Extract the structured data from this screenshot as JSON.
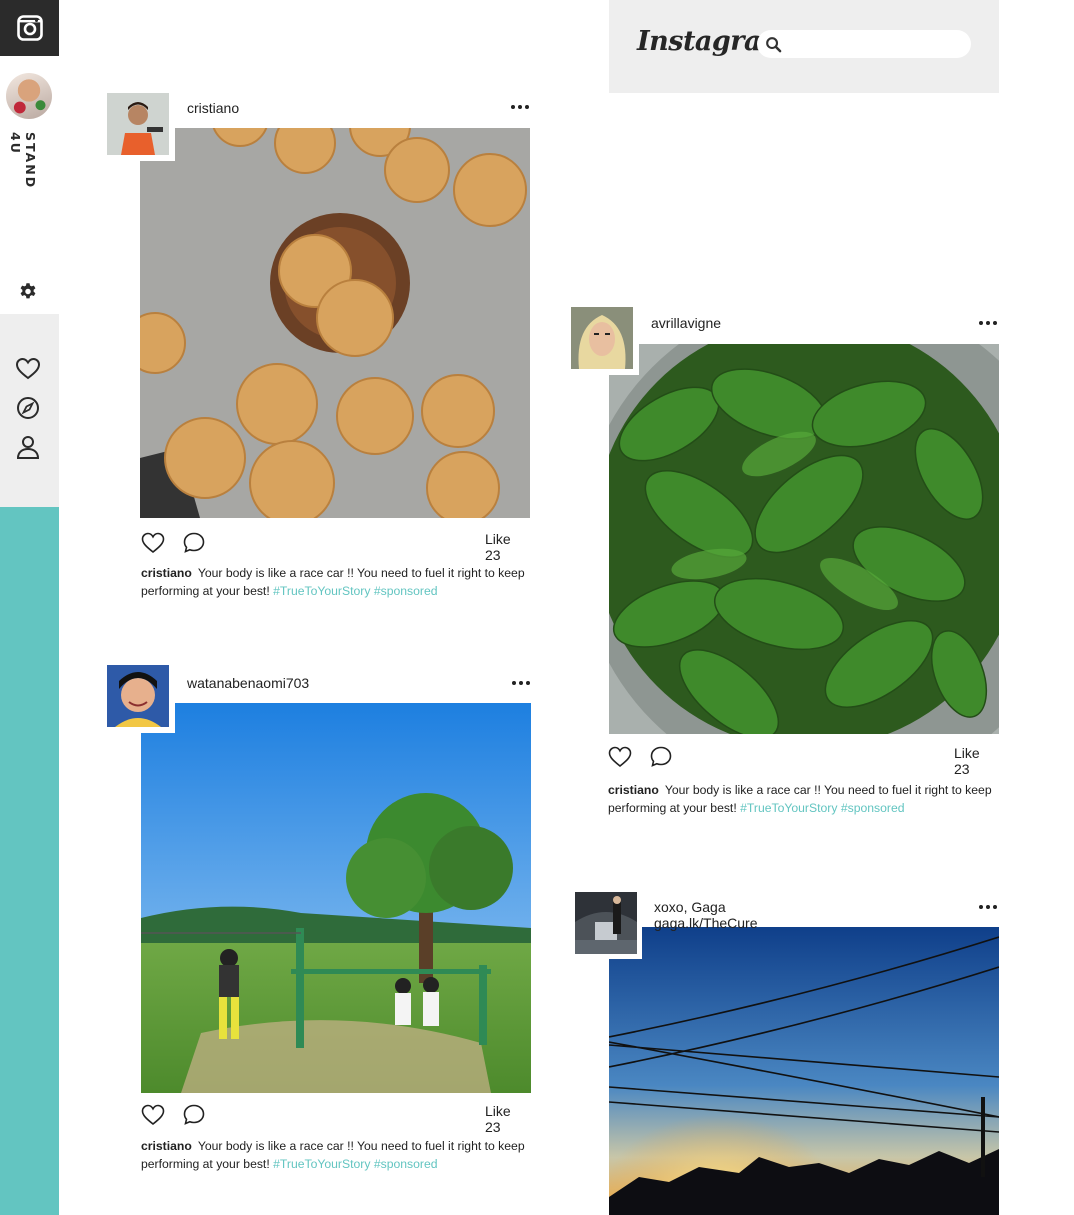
{
  "sidebar": {
    "brand": "STAND 4U",
    "icons": [
      "instagram-icon",
      "profile-avatar",
      "gear-icon",
      "heart-icon",
      "compass-icon",
      "user-icon"
    ]
  },
  "header": {
    "wordmark": "Instagram",
    "search_placeholder": ""
  },
  "posts": [
    {
      "username": "cristiano",
      "like_label": "Like 23",
      "caption_user": "cristiano",
      "caption_text": "Your body is like a race car  !! You need to fuel it right to keep performing at your best!",
      "hashtags": "#TrueToYourStory #sponsored"
    },
    {
      "username": "watanabenaomi703",
      "like_label": "Like 23",
      "caption_user": "cristiano",
      "caption_text": "Your body is like a race car  !! You need to fuel it right to keep performing at your best!",
      "hashtags": "#TrueToYourStory #sponsored"
    },
    {
      "username": "avrillavigne",
      "like_label": "Like 23",
      "caption_user": "cristiano",
      "caption_text": "Your body is like a race car  !! You need to fuel it right to keep performing at your best!",
      "hashtags": "#TrueToYourStory #sponsored"
    },
    {
      "username": "xoxo, Gaga gaga.lk/TheCure"
    }
  ],
  "colors": {
    "accent_teal": "#63c5c1",
    "sidebar_dark": "#2b2b2b",
    "panel_gray": "#eeeeee"
  }
}
